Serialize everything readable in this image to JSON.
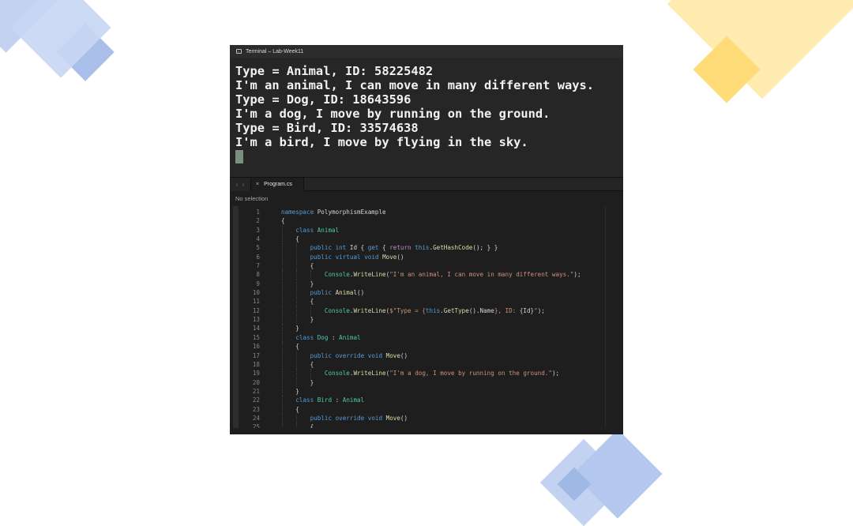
{
  "theme": {
    "deco_blue": "#a9c0ea",
    "deco_blue_dark": "#8ea9e0",
    "deco_yellow": "#ffe39a",
    "deco_yellow_dark": "#ffd45e",
    "terminal_bg": "#262626",
    "editor_bg": "#1e1e1e"
  },
  "terminal": {
    "title": "Terminal – Lab-Week11",
    "icon": "terminal-icon",
    "lines": [
      "Type = Animal, ID: 58225482",
      "I'm an animal, I can move in many different ways.",
      "Type = Dog, ID: 18643596",
      "I'm a dog, I move by running on the ground.",
      "Type = Bird, ID: 33574638",
      "I'm a bird, I move by flying in the sky."
    ]
  },
  "editor": {
    "nav_back": "‹",
    "nav_forward": "›",
    "tab_close": "×",
    "tab_label": "Program.cs",
    "jump_bar": "No selection",
    "line_numbers": [
      "1",
      "2",
      "3",
      "4",
      "5",
      "6",
      "7",
      "8",
      "9",
      "10",
      "11",
      "12",
      "13",
      "14",
      "15",
      "16",
      "17",
      "18",
      "19",
      "20",
      "21",
      "22",
      "23",
      "24",
      "25"
    ],
    "code": [
      [
        {
          "t": "kw",
          "s": "namespace"
        },
        {
          "t": "txt",
          "s": " PolymorphismExample"
        }
      ],
      [
        {
          "t": "txt",
          "s": "{"
        }
      ],
      [
        {
          "t": "txt",
          "s": "    "
        },
        {
          "t": "kw",
          "s": "class"
        },
        {
          "t": "txt",
          "s": " "
        },
        {
          "t": "typ",
          "s": "Animal"
        }
      ],
      [
        {
          "t": "txt",
          "s": "    {"
        }
      ],
      [
        {
          "t": "txt",
          "s": "        "
        },
        {
          "t": "kw",
          "s": "public"
        },
        {
          "t": "txt",
          "s": " "
        },
        {
          "t": "kw",
          "s": "int"
        },
        {
          "t": "txt",
          "s": " Id { "
        },
        {
          "t": "kw",
          "s": "get"
        },
        {
          "t": "txt",
          "s": " { "
        },
        {
          "t": "ctl",
          "s": "return"
        },
        {
          "t": "txt",
          "s": " "
        },
        {
          "t": "kw",
          "s": "this"
        },
        {
          "t": "txt",
          "s": "."
        },
        {
          "t": "fn",
          "s": "GetHashCode"
        },
        {
          "t": "txt",
          "s": "(); } }"
        }
      ],
      [
        {
          "t": "txt",
          "s": "        "
        },
        {
          "t": "kw",
          "s": "public"
        },
        {
          "t": "txt",
          "s": " "
        },
        {
          "t": "kw",
          "s": "virtual"
        },
        {
          "t": "txt",
          "s": " "
        },
        {
          "t": "kw",
          "s": "void"
        },
        {
          "t": "txt",
          "s": " "
        },
        {
          "t": "fn",
          "s": "Move"
        },
        {
          "t": "txt",
          "s": "()"
        }
      ],
      [
        {
          "t": "txt",
          "s": "        {"
        }
      ],
      [
        {
          "t": "txt",
          "s": "            "
        },
        {
          "t": "typ",
          "s": "Console"
        },
        {
          "t": "txt",
          "s": "."
        },
        {
          "t": "fn",
          "s": "WriteLine"
        },
        {
          "t": "txt",
          "s": "("
        },
        {
          "t": "str",
          "s": "\"I'm an animal, I can move in many different ways.\""
        },
        {
          "t": "txt",
          "s": ");"
        }
      ],
      [
        {
          "t": "txt",
          "s": "        }"
        }
      ],
      [
        {
          "t": "txt",
          "s": "        "
        },
        {
          "t": "kw",
          "s": "public"
        },
        {
          "t": "txt",
          "s": " "
        },
        {
          "t": "fn",
          "s": "Animal"
        },
        {
          "t": "txt",
          "s": "()"
        }
      ],
      [
        {
          "t": "txt",
          "s": "        {"
        }
      ],
      [
        {
          "t": "txt",
          "s": "            "
        },
        {
          "t": "typ",
          "s": "Console"
        },
        {
          "t": "txt",
          "s": "."
        },
        {
          "t": "fn",
          "s": "WriteLine"
        },
        {
          "t": "txt",
          "s": "("
        },
        {
          "t": "str",
          "s": "$\"Type = {"
        },
        {
          "t": "kw",
          "s": "this"
        },
        {
          "t": "txt",
          "s": "."
        },
        {
          "t": "fn",
          "s": "GetType"
        },
        {
          "t": "txt",
          "s": "().Name"
        },
        {
          "t": "str",
          "s": "}, ID: "
        },
        {
          "t": "txt",
          "s": "{Id}"
        },
        {
          "t": "str",
          "s": "\""
        },
        {
          "t": "txt",
          "s": ");"
        }
      ],
      [
        {
          "t": "txt",
          "s": "        }"
        }
      ],
      [
        {
          "t": "txt",
          "s": "    }"
        }
      ],
      [
        {
          "t": "txt",
          "s": "    "
        },
        {
          "t": "kw",
          "s": "class"
        },
        {
          "t": "txt",
          "s": " "
        },
        {
          "t": "typ",
          "s": "Dog"
        },
        {
          "t": "txt",
          "s": " : "
        },
        {
          "t": "typ",
          "s": "Animal"
        }
      ],
      [
        {
          "t": "txt",
          "s": "    {"
        }
      ],
      [
        {
          "t": "txt",
          "s": "        "
        },
        {
          "t": "kw",
          "s": "public"
        },
        {
          "t": "txt",
          "s": " "
        },
        {
          "t": "kw",
          "s": "override"
        },
        {
          "t": "txt",
          "s": " "
        },
        {
          "t": "kw",
          "s": "void"
        },
        {
          "t": "txt",
          "s": " "
        },
        {
          "t": "fn",
          "s": "Move"
        },
        {
          "t": "txt",
          "s": "()"
        }
      ],
      [
        {
          "t": "txt",
          "s": "        {"
        }
      ],
      [
        {
          "t": "txt",
          "s": "            "
        },
        {
          "t": "typ",
          "s": "Console"
        },
        {
          "t": "txt",
          "s": "."
        },
        {
          "t": "fn",
          "s": "WriteLine"
        },
        {
          "t": "txt",
          "s": "("
        },
        {
          "t": "str",
          "s": "\"I'm a dog, I move by running on the ground.\""
        },
        {
          "t": "txt",
          "s": ");"
        }
      ],
      [
        {
          "t": "txt",
          "s": "        }"
        }
      ],
      [
        {
          "t": "txt",
          "s": "    }"
        }
      ],
      [
        {
          "t": "txt",
          "s": "    "
        },
        {
          "t": "kw",
          "s": "class"
        },
        {
          "t": "txt",
          "s": " "
        },
        {
          "t": "typ",
          "s": "Bird"
        },
        {
          "t": "txt",
          "s": " : "
        },
        {
          "t": "typ",
          "s": "Animal"
        }
      ],
      [
        {
          "t": "txt",
          "s": "    {"
        }
      ],
      [
        {
          "t": "txt",
          "s": "        "
        },
        {
          "t": "kw",
          "s": "public"
        },
        {
          "t": "txt",
          "s": " "
        },
        {
          "t": "kw",
          "s": "override"
        },
        {
          "t": "txt",
          "s": " "
        },
        {
          "t": "kw",
          "s": "void"
        },
        {
          "t": "txt",
          "s": " "
        },
        {
          "t": "fn",
          "s": "Move"
        },
        {
          "t": "txt",
          "s": "()"
        }
      ],
      [
        {
          "t": "txt",
          "s": "        {"
        }
      ]
    ]
  }
}
